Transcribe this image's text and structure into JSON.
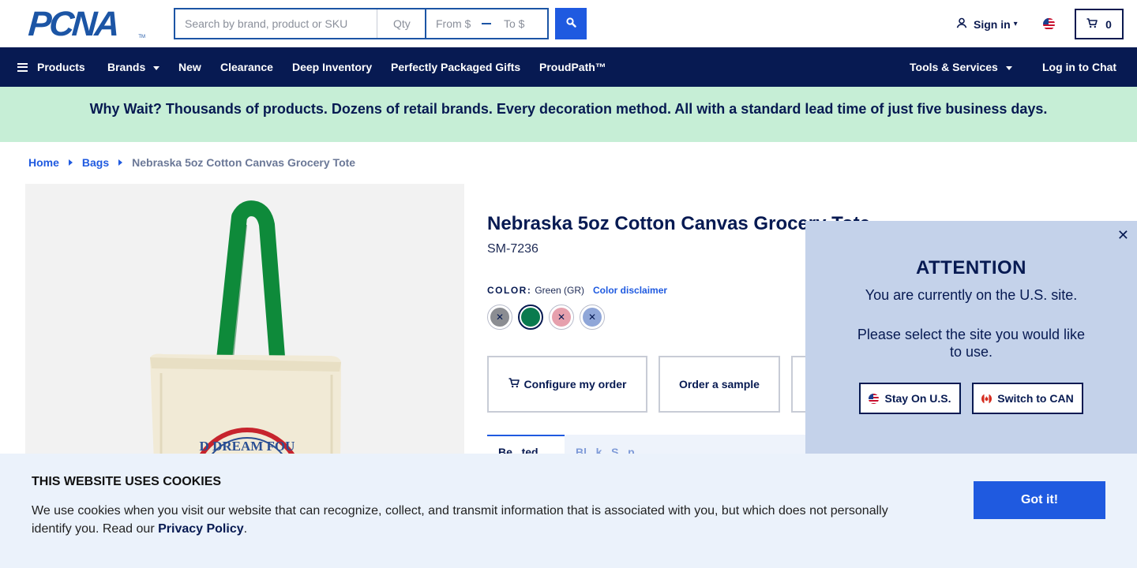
{
  "header": {
    "logo_text": "PCNA",
    "logo_tm": "TM",
    "search": {
      "main_placeholder": "Search by brand, product or SKU",
      "qty_placeholder": "Qty",
      "from_placeholder": "From $",
      "to_placeholder": "To $"
    },
    "sign_in_label": "Sign in",
    "cart_count": "0"
  },
  "nav": {
    "products": "Products",
    "brands": "Brands",
    "new": "New",
    "clearance": "Clearance",
    "deep_inventory": "Deep Inventory",
    "gifts": "Perfectly Packaged Gifts",
    "proudpath": "ProudPath™",
    "tools": "Tools & Services",
    "chat": "Log in to Chat"
  },
  "promo": {
    "text": "Why Wait? Thousands of products. Dozens of retail brands. Every decoration method. All with a standard lead time of just five business days."
  },
  "breadcrumb": {
    "home": "Home",
    "bags": "Bags",
    "current": "Nebraska 5oz Cotton Canvas Grocery Tote"
  },
  "product": {
    "title": "Nebraska 5oz Cotton Canvas Grocery Tote",
    "sku": "SM-7236",
    "color_label": "COLOR:",
    "color_value": "Green (GR)",
    "color_disclaimer": "Color disclaimer",
    "print_text": "D DREAM FOU",
    "swatches": [
      {
        "name": "gray",
        "color": "#8b8d92",
        "unavailable": true
      },
      {
        "name": "green",
        "color": "#0a7a4e",
        "unavailable": false
      },
      {
        "name": "pink",
        "color": "#e6a0ad",
        "unavailable": true
      },
      {
        "name": "blue",
        "color": "#8fa6d8",
        "unavailable": true
      }
    ],
    "configure_label": "Configure my order",
    "sample_label": "Order a sample",
    "tabs": [
      "Be...ted",
      "Bl...k...S...p..."
    ]
  },
  "site_modal": {
    "title": "ATTENTION",
    "line1": "You are currently on the U.S. site.",
    "line2": "Please select the site you would like to use.",
    "stay_label": "Stay On U.S.",
    "switch_label": "Switch to CAN"
  },
  "cookie": {
    "title": "THIS WEBSITE USES COOKIES",
    "text_before": "We use cookies when you visit our website that can recognize, collect, and transmit information that is associated with you, but which does not personally identify you. Read our ",
    "link": "Privacy Policy",
    "text_after": ".",
    "button": "Got it!"
  },
  "colors": {
    "navy": "#071a52",
    "accent_blue": "#1f5ae0",
    "promo_bg": "#c6eed6",
    "modal_bg": "#c4d2ea",
    "cookie_bg": "#ebf2fb"
  }
}
